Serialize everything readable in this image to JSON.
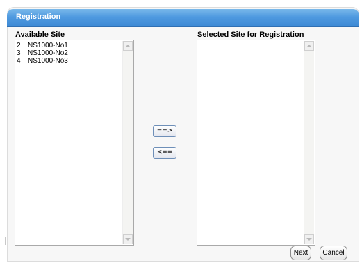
{
  "header": {
    "title": "Registration"
  },
  "available": {
    "label": "Available Site",
    "items": [
      {
        "num": "2",
        "name": "NS1000-No1"
      },
      {
        "num": "3",
        "name": "NS1000-No2"
      },
      {
        "num": "4",
        "name": "NS1000-No3"
      }
    ]
  },
  "selected": {
    "label": "Selected Site for Registration",
    "items": []
  },
  "buttons": {
    "add": "==>",
    "remove": "<==",
    "next": "Next",
    "cancel": "Cancel"
  },
  "colors": {
    "header_top": "#7ab8ea",
    "header_bottom": "#3d89d4",
    "panel_bg": "#f7f7f7"
  }
}
